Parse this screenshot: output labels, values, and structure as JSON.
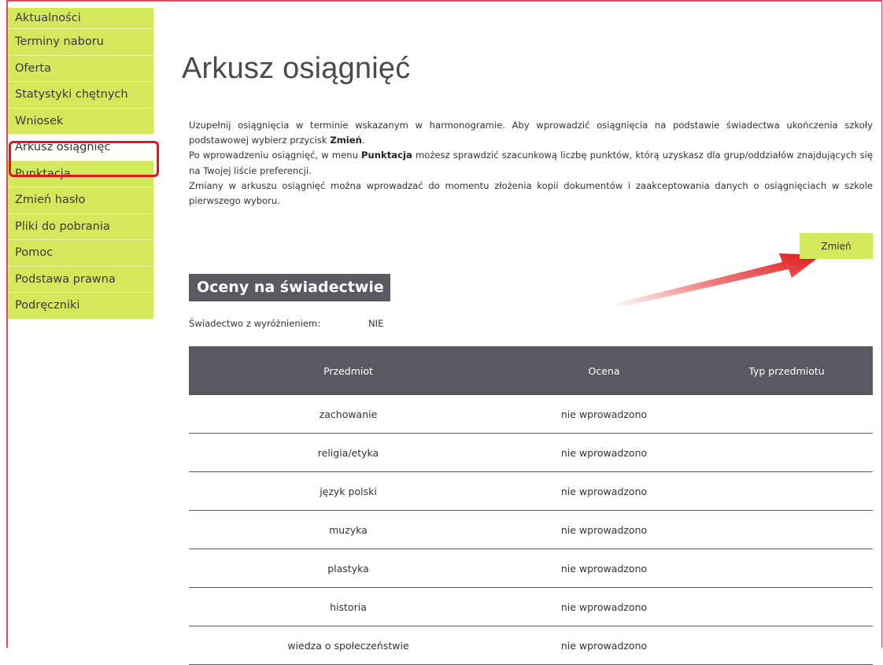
{
  "sidebar": {
    "items": [
      {
        "label": "Aktualności"
      },
      {
        "label": "Terminy naboru"
      },
      {
        "label": "Oferta"
      },
      {
        "label": "Statystyki chętnych"
      },
      {
        "label": "Wniosek"
      },
      {
        "label": "Arkusz osiągnięć"
      },
      {
        "label": "Punktacja"
      },
      {
        "label": "Zmień hasło"
      },
      {
        "label": "Pliki do pobrania"
      },
      {
        "label": "Pomoc"
      },
      {
        "label": "Podstawa prawna"
      },
      {
        "label": "Podręczniki"
      }
    ],
    "active_index": 5
  },
  "page": {
    "title": "Arkusz osiągnięć",
    "intro": {
      "p1_before": "Uzupełnij osiągnięcia w terminie wskazanym w harmonogramie. Aby wprowadzić osiągnięcia na podstawie świadectwa ukończenia szkoły podstawowej wybierz przycisk ",
      "p1_bold": "Zmień",
      "p1_after": ".",
      "p2_before": "Po wprowadzeniu osiągnięć, w menu ",
      "p2_bold": "Punktacja",
      "p2_after": " możesz sprawdzić szacunkową liczbę punktów, którą uzyskasz dla grup/oddziałów znajdujących się na Twojej liście preferencji.",
      "p3": "Zmiany w arkuszu osiągnięć można wprowadzać do momentu złożenia kopii dokumentów i zaakceptowania danych o osiągnięciach w szkole pierwszego wyboru."
    },
    "change_button": "Zmień",
    "section_heading": "Oceny na świadectwie",
    "honors_label": "Świadectwo z wyróżnieniem:",
    "honors_value": "NIE"
  },
  "table": {
    "headers": [
      "Przedmiot",
      "Ocena",
      "Typ przedmiotu"
    ],
    "rows": [
      {
        "subject": "zachowanie",
        "grade": "nie wprowadzono",
        "type": ""
      },
      {
        "subject": "religia/etyka",
        "grade": "nie wprowadzono",
        "type": ""
      },
      {
        "subject": "język polski",
        "grade": "nie wprowadzono",
        "type": ""
      },
      {
        "subject": "muzyka",
        "grade": "nie wprowadzono",
        "type": ""
      },
      {
        "subject": "plastyka",
        "grade": "nie wprowadzono",
        "type": ""
      },
      {
        "subject": "historia",
        "grade": "nie wprowadzono",
        "type": ""
      },
      {
        "subject": "wiedza o społeczeństwie",
        "grade": "nie wprowadzono",
        "type": ""
      }
    ]
  },
  "colors": {
    "accent": "#d3e85b",
    "header_dark": "#5a5962",
    "annotation_red": "#e01818"
  },
  "icons": {
    "annotation": "red-arrow-icon"
  }
}
